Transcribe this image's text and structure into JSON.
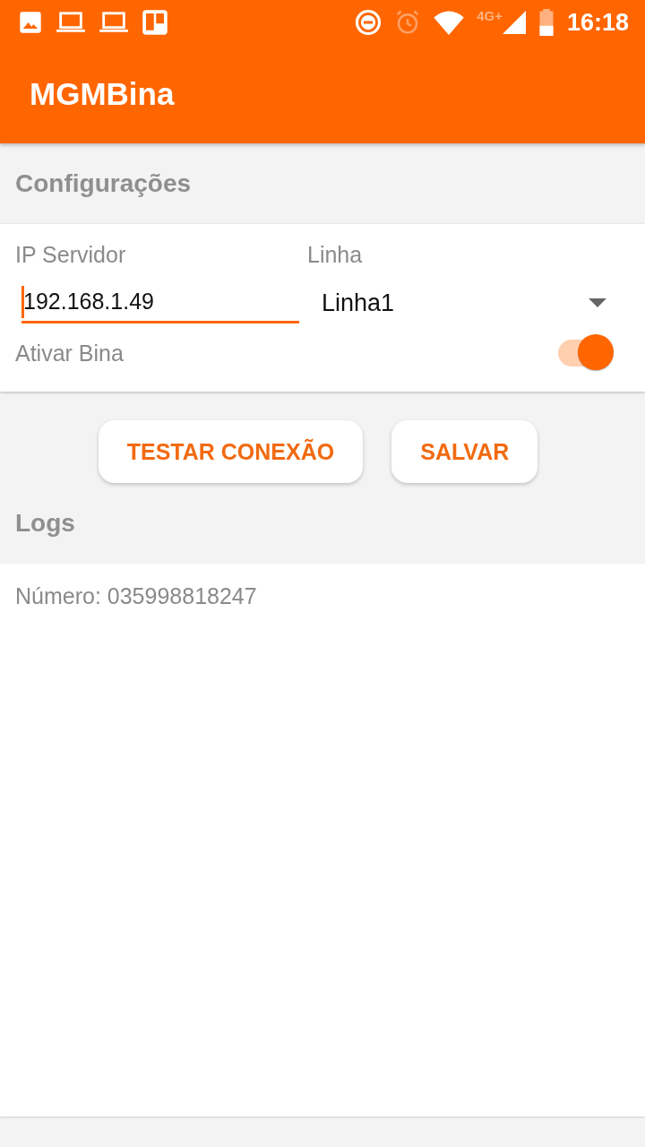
{
  "status_bar": {
    "network": "4G+",
    "time": "16:18"
  },
  "app_bar": {
    "title": "MGMBina"
  },
  "settings": {
    "heading": "Configurações",
    "server_label": "IP Servidor",
    "server_value": "192.168.1.49",
    "line_label": "Linha",
    "line_value": "Linha1",
    "toggle_label": "Ativar Bina",
    "toggle_on": true
  },
  "buttons": [
    "TESTAR CONEXÃO",
    "SALVAR"
  ],
  "logs": {
    "heading": "Logs",
    "entries": [
      "Número: 035998818247"
    ]
  }
}
